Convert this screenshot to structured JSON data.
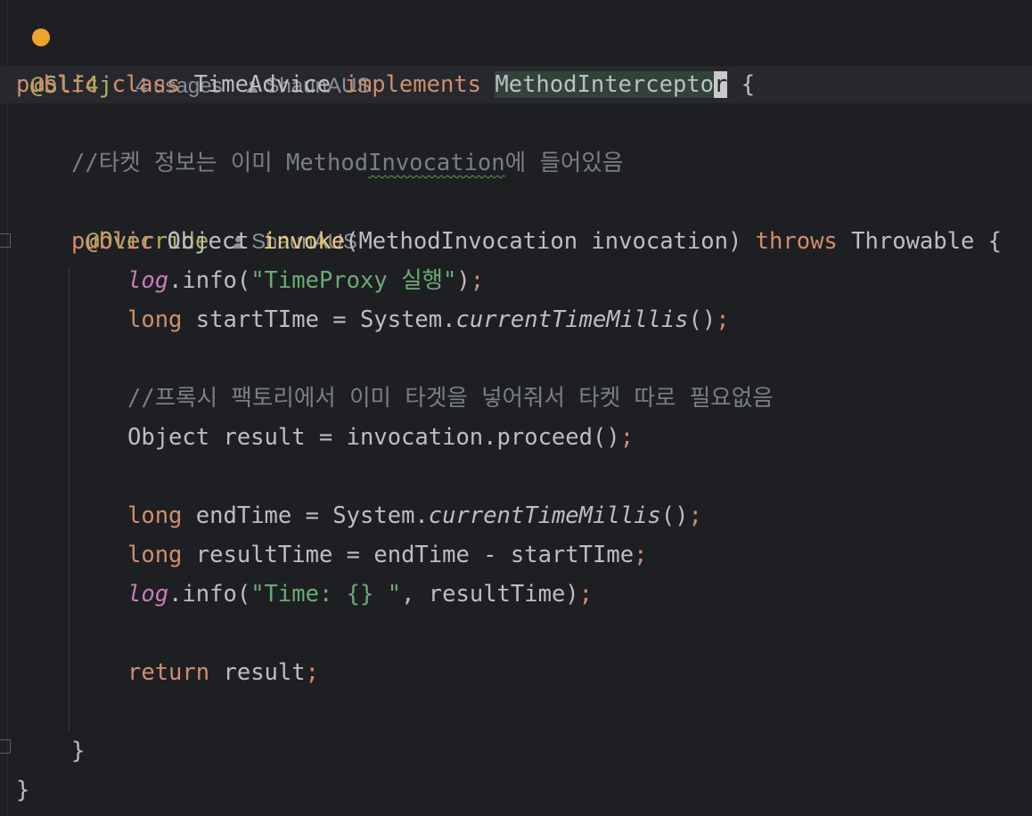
{
  "hints": {
    "usages": "4 usages",
    "author": "ShaunAUS"
  },
  "code": {
    "annotation_slf4j": "@Slf4j",
    "class_kw": "public class",
    "class_name": "TimeAdvice",
    "implements_kw": "implements",
    "interface_name_part": "MethodIntercepto",
    "interface_name_caret": "r",
    "open_brace": "{",
    "comment1_prefix": "//타켓 정보는 이미 Method",
    "comment1_underlined": "Invocation",
    "comment1_suffix": "에 들어있음",
    "override_ann": "@Override",
    "method_public": "public",
    "method_return": "Object",
    "method_name": "invoke",
    "method_params": "(MethodInvocation invocation)",
    "method_throws": "throws",
    "method_exception": "Throwable {",
    "log_field": "log",
    "info_call": ".info(",
    "str_timeproxy": "\"TimeProxy 실행\"",
    "close_call": ")",
    "semicolon": ";",
    "long_kw": "long",
    "start_var": "startTIme = System.",
    "current_time_millis": "currentTimeMillis",
    "empty_parens": "()",
    "comment2": "//프록시 팩토리에서 이미 타겟을 넣어줘서 타켓 따로 필요없음",
    "result_decl": "Object result = invocation.proceed()",
    "end_var": "endTime = System.",
    "result_time_decl": "resultTime = endTime - startTIme",
    "str_time": "\"Time: {} \"",
    "log_args_tail": ", resultTime)",
    "return_kw": "return",
    "return_value": "result",
    "close_method": "}",
    "close_class": "}"
  },
  "colors": {
    "background": "#1e1f22",
    "keyword": "#cf8e6d",
    "annotation": "#b3ae60",
    "string": "#6aab73",
    "comment": "#7a7e85",
    "field": "#c77dbb",
    "method_decl": "#e6c97a"
  }
}
